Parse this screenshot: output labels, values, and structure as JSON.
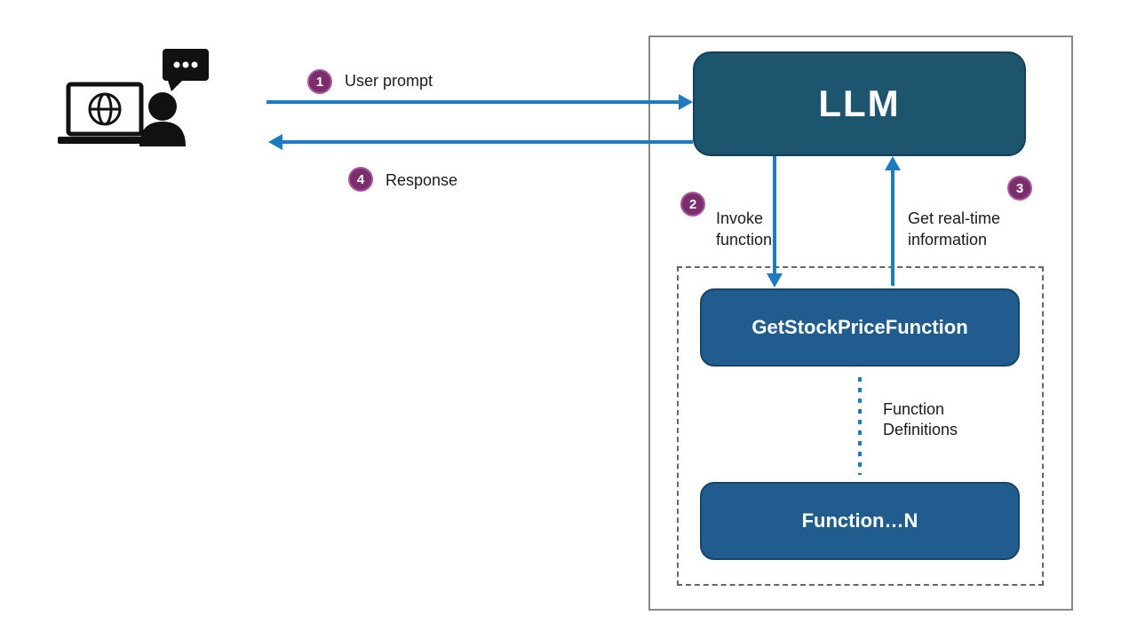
{
  "badges": {
    "one": "1",
    "two": "2",
    "three": "3",
    "four": "4"
  },
  "labels": {
    "user_prompt": "User prompt",
    "response": "Response",
    "invoke_fn": "Invoke\nfunction",
    "realtime": "Get real-time\ninformation",
    "fn_defs": "Function\nDefinitions"
  },
  "boxes": {
    "llm": "LLM",
    "fn1": "GetStockPriceFunction",
    "fn2": "Function…N"
  }
}
